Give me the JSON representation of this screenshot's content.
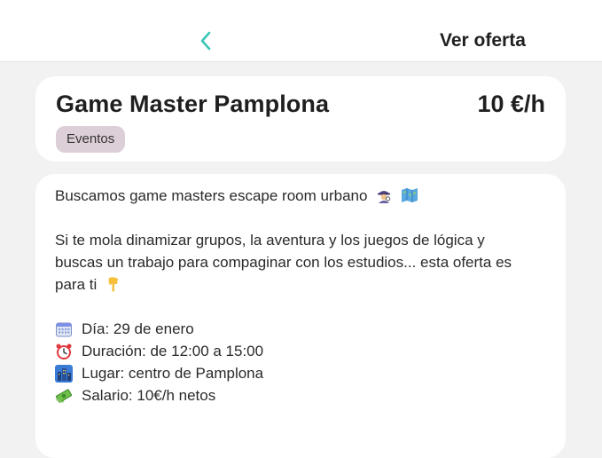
{
  "header": {
    "title": "Ver oferta",
    "back_icon": "chevron-left-icon",
    "accent_color": "#3cc6b5"
  },
  "offer": {
    "title": "Game Master Pamplona",
    "price": "10 €/h",
    "category": "Eventos"
  },
  "description": {
    "intro": "Buscamos game masters escape room urbano",
    "intro_icons": [
      "detective-icon",
      "map-icon"
    ],
    "pitch_1": "Si te mola dinamizar grupos, la aventura y los juegos de lógica y",
    "pitch_2": "buscas un trabajo para compaginar con los estudios... esta oferta es",
    "pitch_3": "para ti",
    "pitch_icon": "pointing-down-icon",
    "details": [
      {
        "icon": "calendar-icon",
        "text": "Día: 29 de enero"
      },
      {
        "icon": "alarm-clock-icon",
        "text": "Duración: de 12:00 a 15:00"
      },
      {
        "icon": "city-icon",
        "text": "Lugar: centro de Pamplona"
      },
      {
        "icon": "money-icon",
        "text": "Salario: 10€/h netos"
      }
    ]
  }
}
